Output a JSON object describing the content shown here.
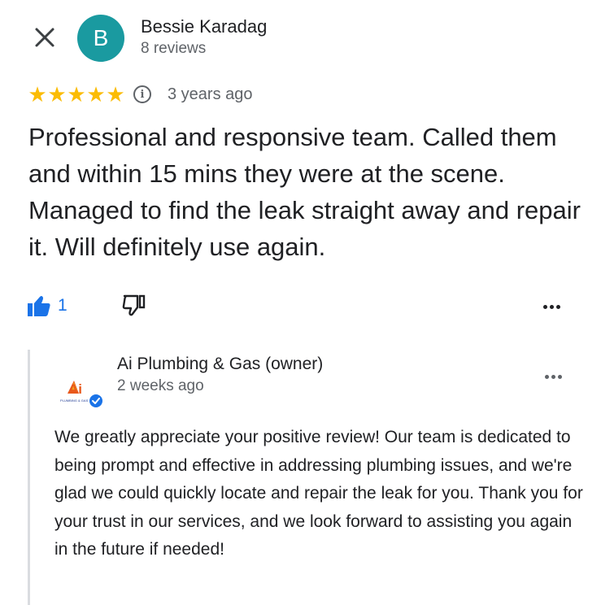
{
  "reviewer": {
    "initial": "B",
    "name": "Bessie Karadag",
    "meta": "8 reviews",
    "avatar_color": "#1a9aa0"
  },
  "rating": {
    "stars": 5,
    "max": 5,
    "age": "3 years ago",
    "star_color": "#fbbc04"
  },
  "review": {
    "text": "Professional and responsive team. Called them and within 15 mins they were at the scene. Managed to find the leak straight away and repair it. Will definitely use again."
  },
  "actions": {
    "like_count": "1",
    "accent_color": "#1a73e8"
  },
  "owner": {
    "name": "Ai Plumbing & Gas (owner)",
    "age": "2 weeks ago",
    "logo_text": "Ai",
    "logo_subtext": "PLUMBING & GAS",
    "reply": "We greatly appreciate your positive review! Our team is dedicated to being prompt and effective in addressing plumbing issues, and we're glad we could quickly locate and repair the leak for you. Thank you for your trust in our services, and we look forward to assisting you again in the future if needed!"
  },
  "icons": {
    "close": "close-icon",
    "info": "info-icon",
    "like": "thumbs-up-icon",
    "dislike": "thumbs-down-icon",
    "more": "more-horiz-icon",
    "verified": "verified-check-icon"
  }
}
